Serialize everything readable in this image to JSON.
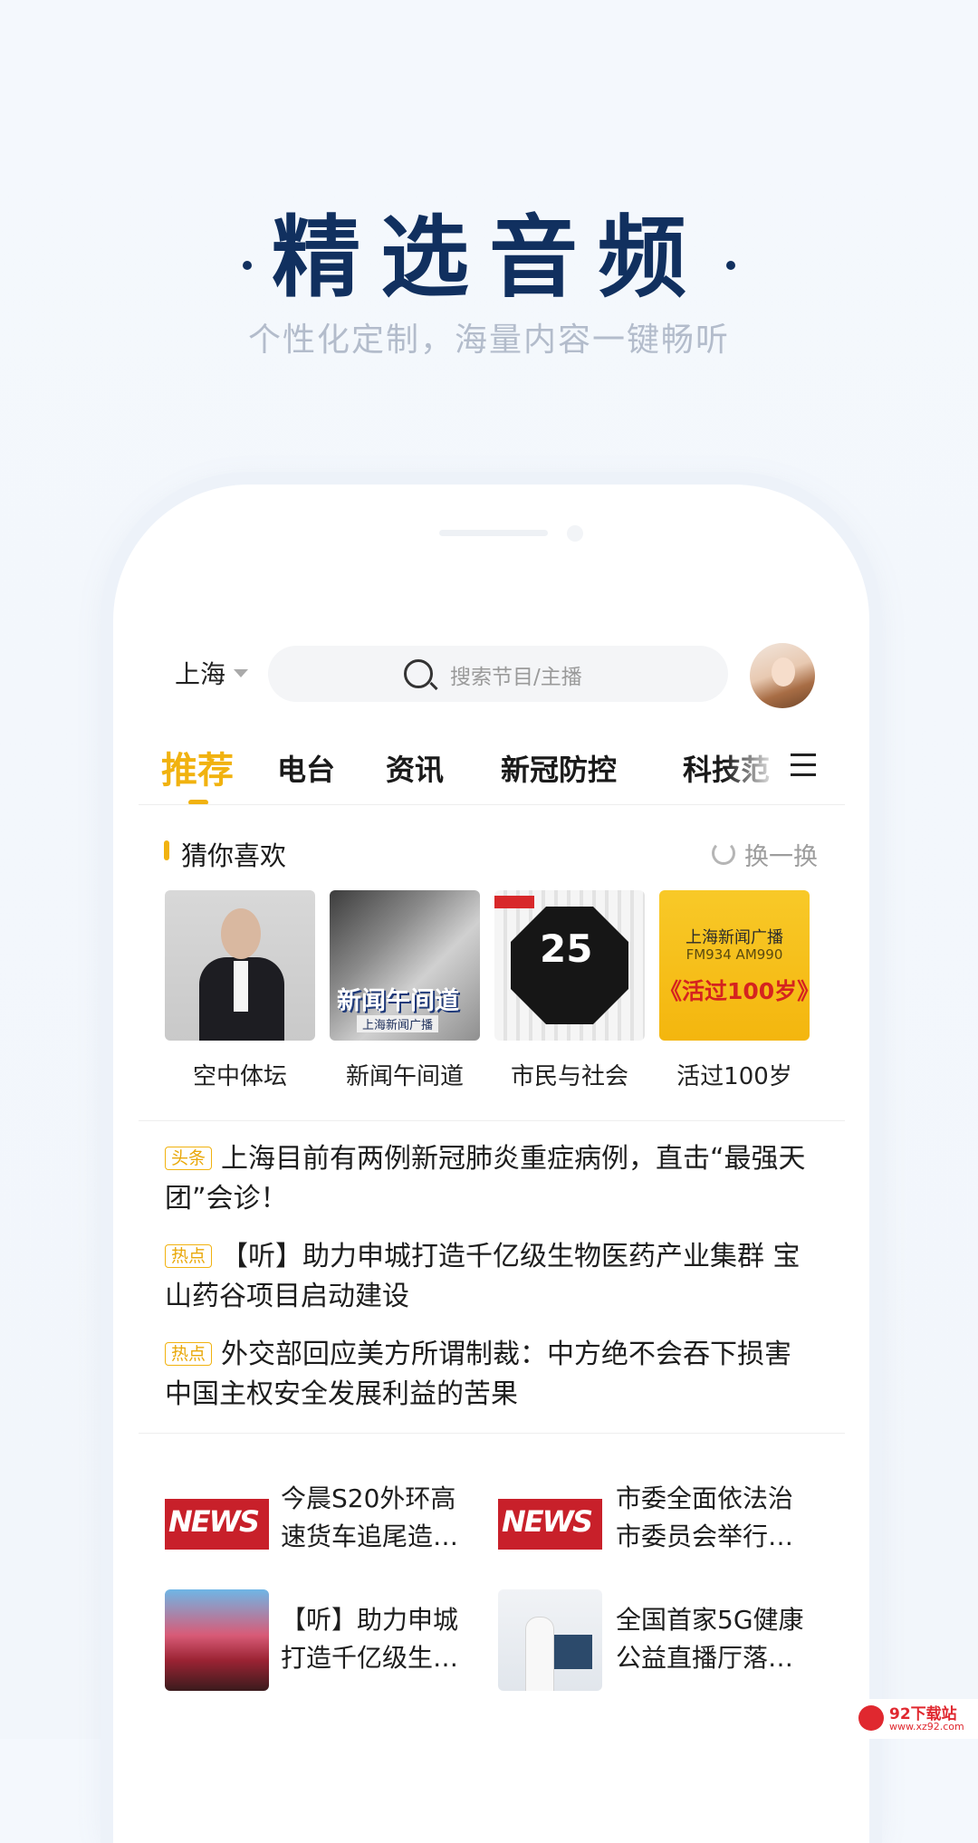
{
  "hero": {
    "title": "精选音频",
    "subtitle": "个性化定制，海量内容一键畅听"
  },
  "header": {
    "city": "上海",
    "search_placeholder": "搜索节目/主播"
  },
  "tabs": [
    {
      "label": "推荐"
    },
    {
      "label": "电台"
    },
    {
      "label": "资讯"
    },
    {
      "label": "新冠防控"
    },
    {
      "label": "科技范"
    }
  ],
  "recommend": {
    "title": "猜你喜欢",
    "refresh_label": "换一换",
    "items": [
      {
        "caption": "空中体坛"
      },
      {
        "caption": "新闻午间道",
        "art_title": "新闻午间道",
        "art_sub": "上海新闻广播"
      },
      {
        "caption": "市民与社会",
        "art_num": "25"
      },
      {
        "caption": "活过100岁",
        "art_line1": "上海新闻广播",
        "art_line2": "FM934 AM990",
        "art_line3": "《活过100岁》"
      }
    ]
  },
  "headlines": [
    {
      "badge": "头条",
      "text": "上海目前有两例新冠肺炎重症病例，直击“最强天团”会诊！"
    },
    {
      "badge": "热点",
      "text": "【听】助力申城打造千亿级生物医药产业集群 宝山药谷项目启动建设"
    },
    {
      "badge": "热点",
      "text": "外交部回应美方所谓制裁：中方绝不会吞下损害中国主权安全发展利益的苦果"
    }
  ],
  "feed": [
    {
      "title_line1": "今晨S20外环高",
      "title_line2": "速货车追尾造…",
      "thumb_text": "NEWS"
    },
    {
      "title_line1": "市委全面依法治",
      "title_line2": "市委员会举行…",
      "thumb_text": "NEWS"
    },
    {
      "title_line1": "【听】助力申城",
      "title_line2": "打造千亿级生…"
    },
    {
      "title_line1": "全国首家5G健康",
      "title_line2": "公益直播厅落…"
    }
  ],
  "watermark": {
    "name": "92下载站",
    "url": "www.xz92.com"
  },
  "colors": {
    "accent": "#f1b20f",
    "title": "#11305f",
    "badge": "#e9a80a"
  }
}
